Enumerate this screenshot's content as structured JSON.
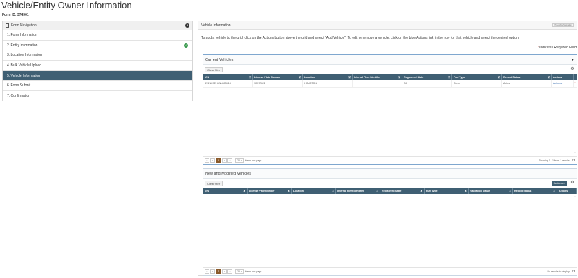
{
  "page": {
    "title": "Vehicle/Entity Owner Information",
    "form_id": "Form ID: 374901"
  },
  "nav": {
    "header": "Form Navigation",
    "items": [
      {
        "label": "1. Form Information",
        "active": false,
        "complete": false
      },
      {
        "label": "2. Entity Information",
        "active": false,
        "complete": true
      },
      {
        "label": "3. Location Information",
        "active": false,
        "complete": false
      },
      {
        "label": "4. Bulk Vehicle Upload",
        "active": false,
        "complete": false
      },
      {
        "label": "5. Vehicle Information",
        "active": true,
        "complete": false
      },
      {
        "label": "6. Form Submit",
        "active": false,
        "complete": false
      },
      {
        "label": "7. Confirmation",
        "active": false,
        "complete": false
      }
    ]
  },
  "main": {
    "header": "Vehicle Information",
    "toggle_label": "Hide/Show Navigation",
    "instructions": "To add a vehicle to the grid, click on the Actions button above the grid and select \"Add Vehicle\". To edit or remove a vehicle, click on the blue Actions link in the row for that vehicle and select the desired option.",
    "required_note": "Indicates Required Field"
  },
  "current_grid": {
    "title": "Current Vehicles",
    "clear_filter": "Clear filter",
    "columns": [
      "VIN",
      "License Plate Number",
      "Location",
      "Internal Fleet Identifier",
      "Registered State",
      "Fuel Type",
      "Record Status",
      "Actions"
    ],
    "rows": [
      [
        "4V4NC9EH6NN603513",
        "9PNR422",
        "HOUSTON",
        "",
        "CA",
        "Diesel",
        "Active",
        "Actions"
      ]
    ],
    "page": "1",
    "page_size": "20",
    "items_per_page": "items per page",
    "info": "Showing 1 - 1 from 1 results"
  },
  "new_grid": {
    "title": "New and Modified Vehicles",
    "clear_filter": "Clear filter",
    "actions_label": "Actions",
    "columns": [
      "VIN",
      "License Plate Number",
      "Location",
      "Internal Fleet Identifier",
      "Registered State",
      "Fuel Type",
      "Validation Status",
      "Record Status",
      "Actions"
    ],
    "page": "0",
    "page_size": "20",
    "items_per_page": "items per page",
    "info": "No results to display"
  },
  "colors": {
    "header_bg": "#3f5f73",
    "active_nav": "#3f5f73",
    "check": "#3a9a4e",
    "page_active": "#8a5a2b",
    "link": "#3a6fb0"
  }
}
